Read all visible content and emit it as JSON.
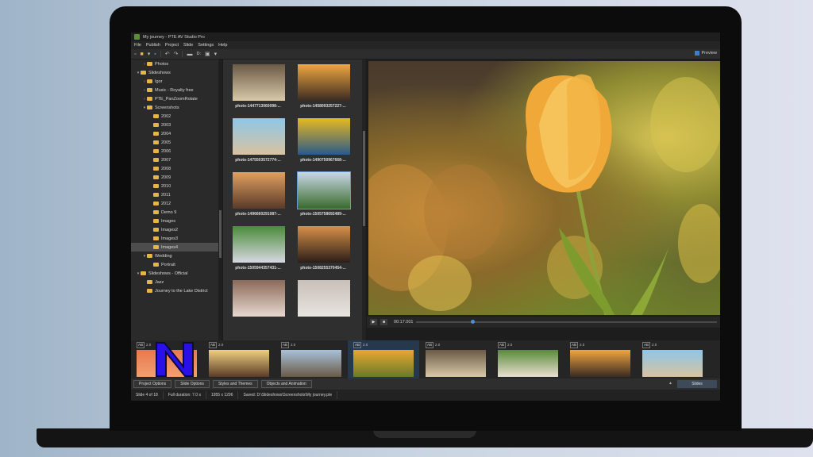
{
  "window": {
    "title": "My journey - PTE AV Studio Pro"
  },
  "menu": [
    "File",
    "Publish",
    "Project",
    "Slide",
    "Settings",
    "Help"
  ],
  "toolbar": {
    "drive_label": "D:",
    "preview_label": "Preview"
  },
  "folder_tree": [
    {
      "label": "Photos",
      "level": 1,
      "arrow": ">"
    },
    {
      "label": "Slideshows",
      "level": 0,
      "arrow": "v"
    },
    {
      "label": "Igor",
      "level": 1,
      "arrow": ">"
    },
    {
      "label": "Music - Royalty free",
      "level": 1,
      "arrow": ">"
    },
    {
      "label": "PTE_PanZoomRotate",
      "level": 1,
      "arrow": ">"
    },
    {
      "label": "Screenshots",
      "level": 1,
      "arrow": "v"
    },
    {
      "label": "2002",
      "level": 2,
      "arrow": ""
    },
    {
      "label": "2003",
      "level": 2,
      "arrow": ""
    },
    {
      "label": "2004",
      "level": 2,
      "arrow": ""
    },
    {
      "label": "2005",
      "level": 2,
      "arrow": ""
    },
    {
      "label": "2006",
      "level": 2,
      "arrow": ""
    },
    {
      "label": "2007",
      "level": 2,
      "arrow": ""
    },
    {
      "label": "2008",
      "level": 2,
      "arrow": ""
    },
    {
      "label": "2009",
      "level": 2,
      "arrow": ""
    },
    {
      "label": "2010",
      "level": 2,
      "arrow": ""
    },
    {
      "label": "2011",
      "level": 2,
      "arrow": ""
    },
    {
      "label": "2012",
      "level": 2,
      "arrow": ""
    },
    {
      "label": "Demo 9",
      "level": 2,
      "arrow": ""
    },
    {
      "label": "Images",
      "level": 2,
      "arrow": ""
    },
    {
      "label": "Images2",
      "level": 2,
      "arrow": ""
    },
    {
      "label": "Images3",
      "level": 2,
      "arrow": ""
    },
    {
      "label": "Images4",
      "level": 2,
      "arrow": "",
      "selected": true
    },
    {
      "label": "Wedding",
      "level": 1,
      "arrow": "v"
    },
    {
      "label": "Portrait",
      "level": 2,
      "arrow": ""
    },
    {
      "label": "Slideshows - Official",
      "level": 0,
      "arrow": "v"
    },
    {
      "label": "Jazz",
      "level": 1,
      "arrow": ""
    },
    {
      "label": "Journey to the Lake District",
      "level": 1,
      "arrow": ""
    }
  ],
  "thumbnails": [
    {
      "caption": "photo-1447713060098-...",
      "colors": [
        "#6b5a45",
        "#d8c9a8"
      ]
    },
    {
      "caption": "photo-1458093257227-...",
      "colors": [
        "#f0a640",
        "#3a2b22"
      ]
    },
    {
      "caption": "photo-1475503572774-...",
      "colors": [
        "#8ec6e8",
        "#d9c3a0"
      ]
    },
    {
      "caption": "photo-1490750967668-...",
      "colors": [
        "#e8b820",
        "#2a5a8a"
      ]
    },
    {
      "caption": "photo-1496660291087-...",
      "colors": [
        "#e0a060",
        "#5a3a28"
      ]
    },
    {
      "caption": "photo-1505758692489-...",
      "colors": [
        "#c8d8e8",
        "#3a6a2a"
      ]
    },
    {
      "caption": "photo-1505944357431-...",
      "colors": [
        "#4a8a3a",
        "#d8d8e0"
      ]
    },
    {
      "caption": "photo-1508255370454-...",
      "colors": [
        "#d89048",
        "#2a1e18"
      ]
    },
    {
      "caption": "",
      "colors": [
        "#8a6a58",
        "#e8d8d0"
      ]
    },
    {
      "caption": "",
      "colors": [
        "#c8c0b8",
        "#e8e4e0"
      ]
    }
  ],
  "playback": {
    "time": "00:17.001",
    "progress": 0.18
  },
  "timeline": [
    {
      "ab": "AB",
      "dur": "2.0",
      "caption": "1. ic'ldi",
      "colors": [
        "#e87850",
        "#f2a070"
      ]
    },
    {
      "ab": "AB",
      "dur": "2.0",
      "caption": "2. photo-142927765502-eed...",
      "colors": [
        "#f0d080",
        "#5a3c28"
      ],
      "badge": "5.0"
    },
    {
      "ab": "AB",
      "dur": "2.0",
      "caption": "3. photo-143439417884-0b0...",
      "colors": [
        "#a8c0d8",
        "#6a5a48"
      ],
      "badge": "5.0"
    },
    {
      "ab": "AB",
      "dur": "2.0",
      "caption": "4. photo-142255806704-1f8f...",
      "colors": [
        "#e8a830",
        "#6a7a2a"
      ],
      "badge": "5.0",
      "active": true
    },
    {
      "ab": "AB",
      "dur": "2.0",
      "caption": "5. photo-1447713066098-74c...",
      "colors": [
        "#6b5a45",
        "#d8c9a8"
      ],
      "badge": "5.0"
    },
    {
      "ab": "AB",
      "dur": "2.0",
      "caption": "6. 1",
      "colors": [
        "#5a8a3a",
        "#e8e0d0"
      ],
      "badge": "5.0"
    },
    {
      "ab": "AB",
      "dur": "2.0",
      "caption": "7. photo-1458092527227-0f5...",
      "colors": [
        "#f0a640",
        "#3a2b22"
      ],
      "badge": "5.0"
    },
    {
      "ab": "AB",
      "dur": "2.0",
      "caption": "8. photo-1475503572774-15a...",
      "colors": [
        "#8ec6e8",
        "#d9c3a0"
      ],
      "badge": "5.0"
    }
  ],
  "tabs": [
    "Project Options",
    "Slide Options",
    "Styles and Themes",
    "Objects and Animation"
  ],
  "slides_button": "Slides",
  "status": {
    "slide": "Slide 4 of 18",
    "duration": "Full duration: 7.0 s",
    "resolution": "1955 x 1296",
    "saved": "Saved: D:\\Slideshows\\Screenshots\\My journey.pte"
  },
  "colors": {
    "accent": "#4a8fd8",
    "folder": "#e7b546",
    "watermark": "#2a10e8"
  }
}
